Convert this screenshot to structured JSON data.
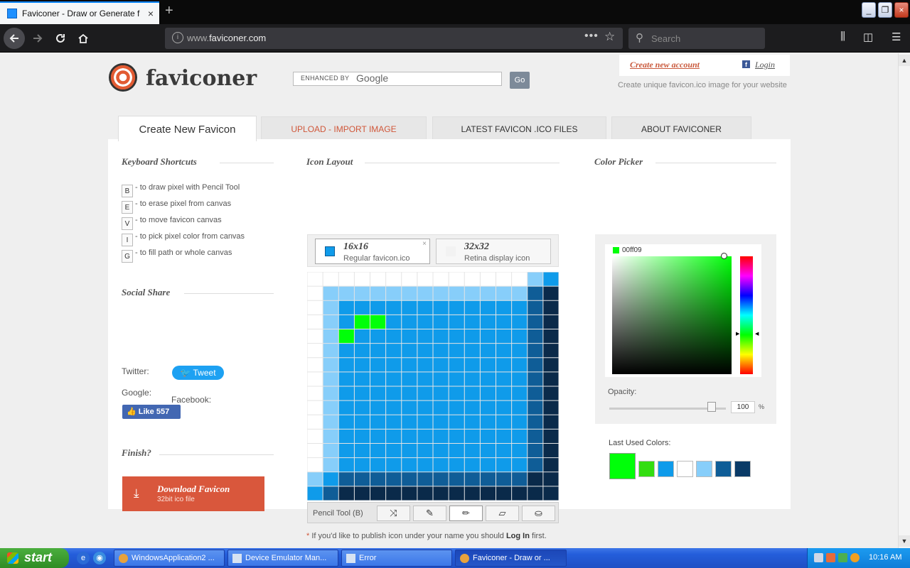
{
  "browser": {
    "tab_title": "Faviconer - Draw or Generate fav",
    "url_prefix": "www.",
    "url_domain": "faviconer.com",
    "search_placeholder": "Search",
    "new_tab": "+",
    "tab_close": "×",
    "win_minimize": "_",
    "win_maximize": "❐",
    "win_close": "×"
  },
  "header": {
    "logo_text": "faviconer",
    "search_prefix": "ENHANCED BY",
    "search_brand": "Google",
    "go_label": "Go",
    "create_account": "Create new account",
    "login": "Login",
    "facebook_glyph": "f",
    "tagline": "Create unique favicon.ico image for your website"
  },
  "tabs": [
    {
      "label": "Create New Favicon"
    },
    {
      "label": "UPLOAD - IMPORT IMAGE"
    },
    {
      "label": "LATEST FAVICON .ICO FILES"
    },
    {
      "label": "ABOUT FAVICONER"
    }
  ],
  "shortcuts": {
    "title": "Keyboard Shortcuts",
    "items": [
      {
        "key": "B",
        "desc": "- to draw pixel with Pencil Tool"
      },
      {
        "key": "E",
        "desc": "- to erase pixel from canvas"
      },
      {
        "key": "V",
        "desc": "- to move favicon canvas"
      },
      {
        "key": "I",
        "desc": "- to pick pixel color from canvas"
      },
      {
        "key": "G",
        "desc": "- to fill path or whole canvas"
      }
    ]
  },
  "social": {
    "title": "Social Share",
    "twitter_label": "Twitter:",
    "tweet_button": "Tweet",
    "google_label": "Google:",
    "facebook_label": "Facebook:",
    "like_button": "Like 557"
  },
  "finish": {
    "title": "Finish?",
    "download_label": "Download Favicon",
    "download_sub": "32bit ico file"
  },
  "icon_layout": {
    "title": "Icon Layout",
    "size16": {
      "size": "16x16",
      "desc": "Regular favicon.ico",
      "close": "×"
    },
    "size32": {
      "size": "32x32",
      "desc": "Retina display icon"
    },
    "tool_label": "Pencil Tool (B)",
    "tools": [
      "move-tool",
      "picker-tool",
      "pencil-tool",
      "eraser-tool",
      "fill-tool"
    ],
    "active_tool": "pencil-tool",
    "note_pre": "If you'd like to publish icon under your name you should",
    "note_link": "Log In",
    "note_post": "first.",
    "note_asterisk": "*"
  },
  "canvas": {
    "palette": {
      "W": "#ffffff",
      "L": "#87cefa",
      "B": "#0f9bea",
      "M": "#0f5d97",
      "D": "#0a2a4a",
      "G": "#00ff09"
    },
    "rows": [
      "WWWWWWWWWWWWWWLB",
      "WLLLLLLLLLLLLLMD",
      "WLBBBBBBBBBBBBMD",
      "WLBGGBBBBBBBBBMD",
      "WLGBBBBBBBBBBBMD",
      "WLBBBBBBBBBBBBMD",
      "WLBBBBBBBBBBBBMD",
      "WLBBBBBBBBBBBBMD",
      "WLBBBBBBBBBBBBMD",
      "WLBBBBBBBBBBBBMD",
      "WLBBBBBBBBBBBBMD",
      "WLBBBBBBBBBBBBMD",
      "WLBBBBBBBBBBBBMD",
      "WLBBBBBBBBBBBBMD",
      "LBMMMMMMMMMMMMDD",
      "BMDDDDDDDDDDDDDD"
    ]
  },
  "color_picker": {
    "title": "Color Picker",
    "hex": "00ff09",
    "opacity_label": "Opacity:",
    "opacity_value": "100",
    "opacity_unit": "%",
    "last_used_label": "Last Used Colors:",
    "last_used": [
      "#00ff09",
      "#33dd11",
      "#0f9bea",
      "#ffffff",
      "#87cefa",
      "#0f5d97",
      "#0a3a66"
    ]
  },
  "taskbar": {
    "start": "start",
    "tasks": [
      {
        "label": "WindowsApplication2 ..."
      },
      {
        "label": "Device Emulator Man..."
      },
      {
        "label": "Error"
      },
      {
        "label": "Faviconer - Draw or ..."
      }
    ],
    "clock": "10:16 AM"
  }
}
